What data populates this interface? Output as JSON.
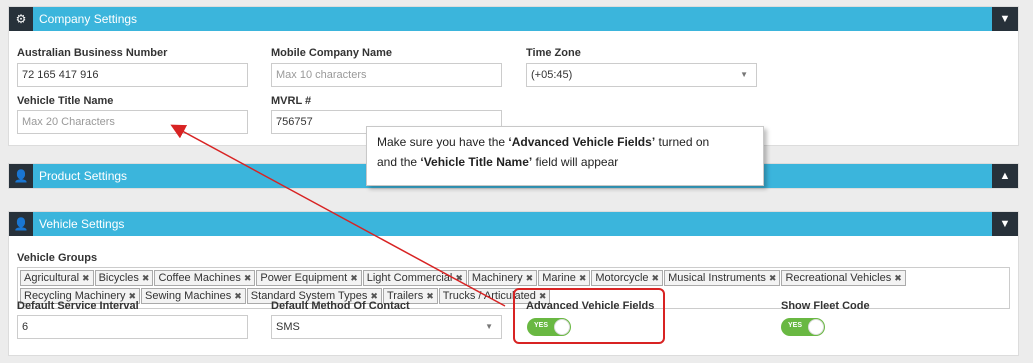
{
  "company": {
    "title": "Company Settings",
    "icon": "gear-icon",
    "abn_label": "Australian Business Number",
    "abn_value": "72 165 417 916",
    "mobile_label": "Mobile Company Name",
    "mobile_placeholder": "Max 10 characters",
    "timezone_label": "Time Zone",
    "timezone_value": "(+05:45)",
    "vehicle_title_label": "Vehicle Title Name",
    "vehicle_title_placeholder": "Max 20 Characters",
    "mvrl_label": "MVRL #",
    "mvrl_value": "756757"
  },
  "product": {
    "title": "Product Settings",
    "icon": "user-icon"
  },
  "vehicle": {
    "title": "Vehicle Settings",
    "icon": "user-icon",
    "groups_label": "Vehicle Groups",
    "groups": [
      "Agricultural",
      "Bicycles",
      "Coffee Machines",
      "Power Equipment",
      "Light Commercial",
      "Machinery",
      "Marine",
      "Motorcycle",
      "Musical Instruments",
      "Recreational Vehicles",
      "Recycling Machinery",
      "Sewing Machines",
      "Standard System Types",
      "Trailers",
      "Trucks / Articulated"
    ],
    "service_interval_label": "Default Service Interval",
    "service_interval_value": "6",
    "contact_method_label": "Default Method Of Contact",
    "contact_method_value": "SMS",
    "advanced_fields_label": "Advanced Vehicle Fields",
    "advanced_fields_toggle": "YES",
    "fleet_code_label": "Show Fleet Code",
    "fleet_code_toggle": "YES"
  },
  "callout": {
    "line1_pre": "Make sure you have the ",
    "line1_bold": "‘Advanced Vehicle Fields’",
    "line1_post": " turned on",
    "line2_pre": "and the ",
    "line2_bold": "‘Vehicle Title Name’",
    "line2_post": " field will appear"
  },
  "colors": {
    "header": "#3bb5dc",
    "dark": "#27313a",
    "toggle_on": "#69b842",
    "annotation": "#d82323"
  }
}
